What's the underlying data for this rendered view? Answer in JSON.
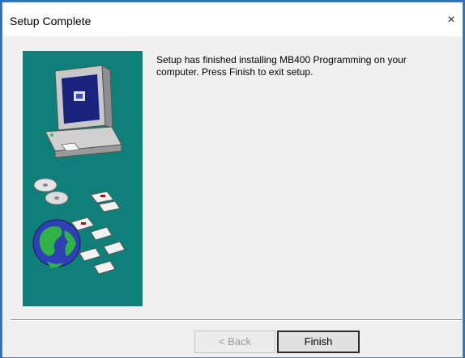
{
  "window": {
    "title": "Setup Complete",
    "close_glyph": "×"
  },
  "message": "Setup has finished installing MB400 Programming on your\ncomputer. Press Finish to exit setup.",
  "buttons": {
    "back_label": "< Back",
    "finish_label": "Finish"
  },
  "colors": {
    "panel": "#0f7f7a",
    "titlebar": "#ffffff",
    "dialog": "#f0f0f0"
  },
  "panel_icons": [
    "computer-icon",
    "cd-disc-icon",
    "floppy-disk-icon",
    "globe-icon"
  ]
}
